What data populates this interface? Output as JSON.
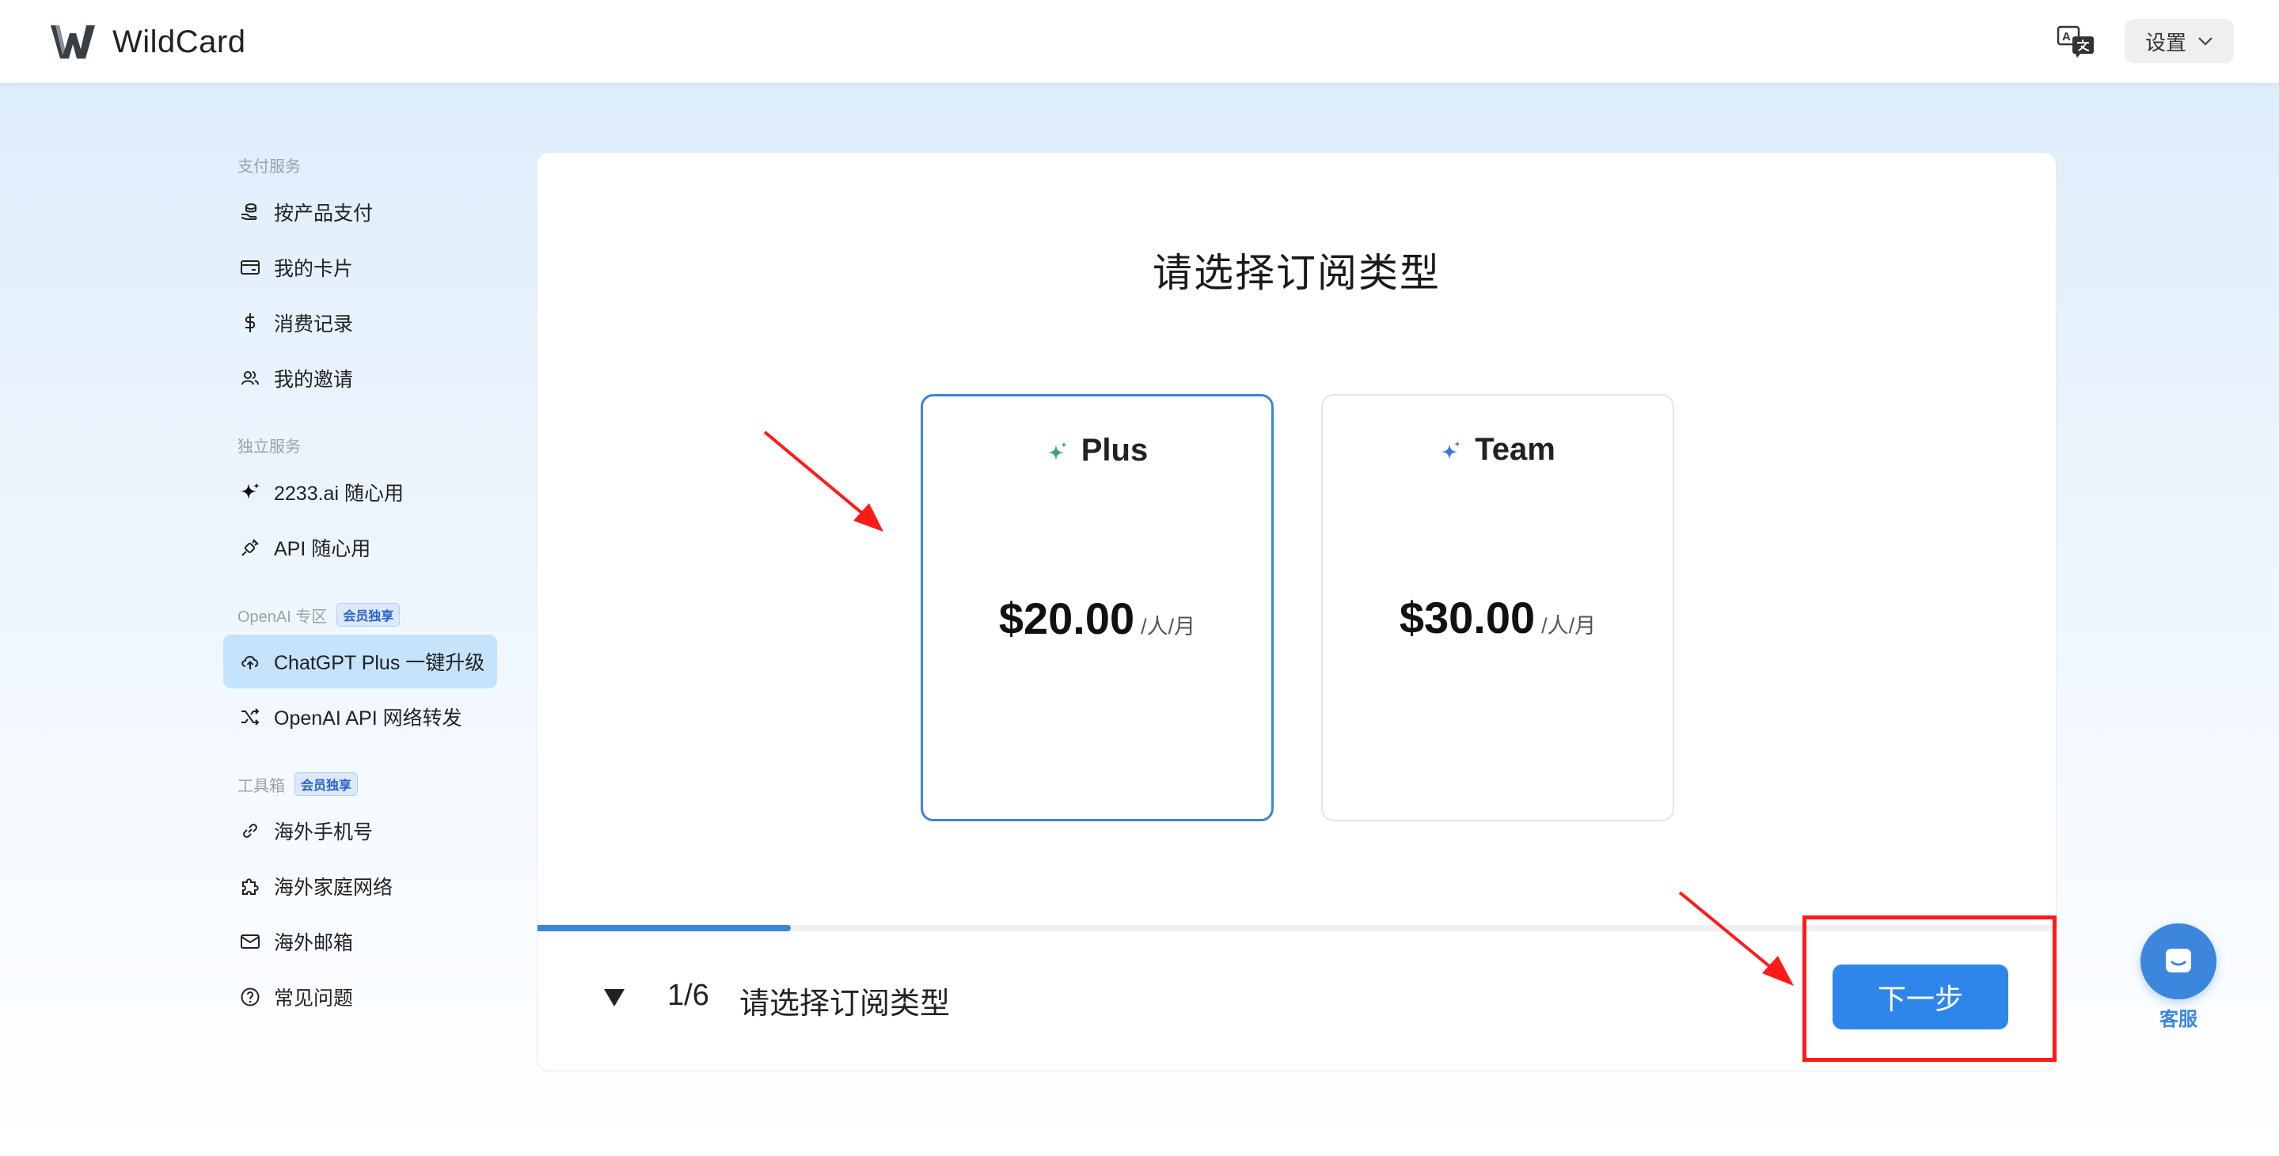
{
  "header": {
    "brand_name": "WildCard",
    "settings_label": "设置",
    "icons": {
      "logo": "wildcard-w-logo",
      "language": "translate-icon",
      "settings_caret": "chevron-down-icon"
    }
  },
  "sidebar": {
    "sections": [
      {
        "title": "支付服务",
        "badge": "",
        "items": [
          {
            "label": "按产品支付",
            "icon": "coin-hand-icon"
          },
          {
            "label": "我的卡片",
            "icon": "credit-card-icon"
          },
          {
            "label": "消费记录",
            "icon": "dollar-icon"
          },
          {
            "label": "我的邀请",
            "icon": "users-icon"
          }
        ]
      },
      {
        "title": "独立服务",
        "badge": "",
        "items": [
          {
            "label": "2233.ai 随心用",
            "icon": "sparkle-icon"
          },
          {
            "label": "API 随心用",
            "icon": "plug-icon"
          }
        ]
      },
      {
        "title": "OpenAI 专区",
        "badge": "会员独享",
        "items": [
          {
            "label": "ChatGPT Plus 一键升级",
            "icon": "cloud-upload-icon",
            "active": true
          },
          {
            "label": "OpenAI API 网络转发",
            "icon": "shuffle-icon"
          }
        ]
      },
      {
        "title": "工具箱",
        "badge": "会员独享",
        "items": [
          {
            "label": "海外手机号",
            "icon": "link-icon"
          },
          {
            "label": "海外家庭网络",
            "icon": "puzzle-icon"
          },
          {
            "label": "海外邮箱",
            "icon": "mail-icon"
          },
          {
            "label": "常见问题",
            "icon": "question-circle-icon"
          }
        ]
      }
    ]
  },
  "main": {
    "title": "请选择订阅类型",
    "plans": [
      {
        "name": "Plus",
        "price": "$20.00",
        "unit": "/人/月",
        "selected": true,
        "icon": "sparkle-green-icon",
        "icon_color": "#3aa57a"
      },
      {
        "name": "Team",
        "price": "$30.00",
        "unit": "/人/月",
        "selected": false,
        "icon": "sparkle-blue-icon",
        "icon_color": "#3b78d8"
      }
    ],
    "progress": {
      "current": 1,
      "total": 6,
      "fraction": 0.1667
    },
    "step_count": "1/6",
    "step_label": "请选择订阅类型",
    "next_label": "下一步"
  },
  "support": {
    "label": "客服",
    "icon": "chat-bubble-icon"
  },
  "colors": {
    "accent": "#2e86ea",
    "selected_border": "#3b86d9",
    "annotation": "#ff1a1a",
    "active_nav": "#c5e3fb"
  }
}
